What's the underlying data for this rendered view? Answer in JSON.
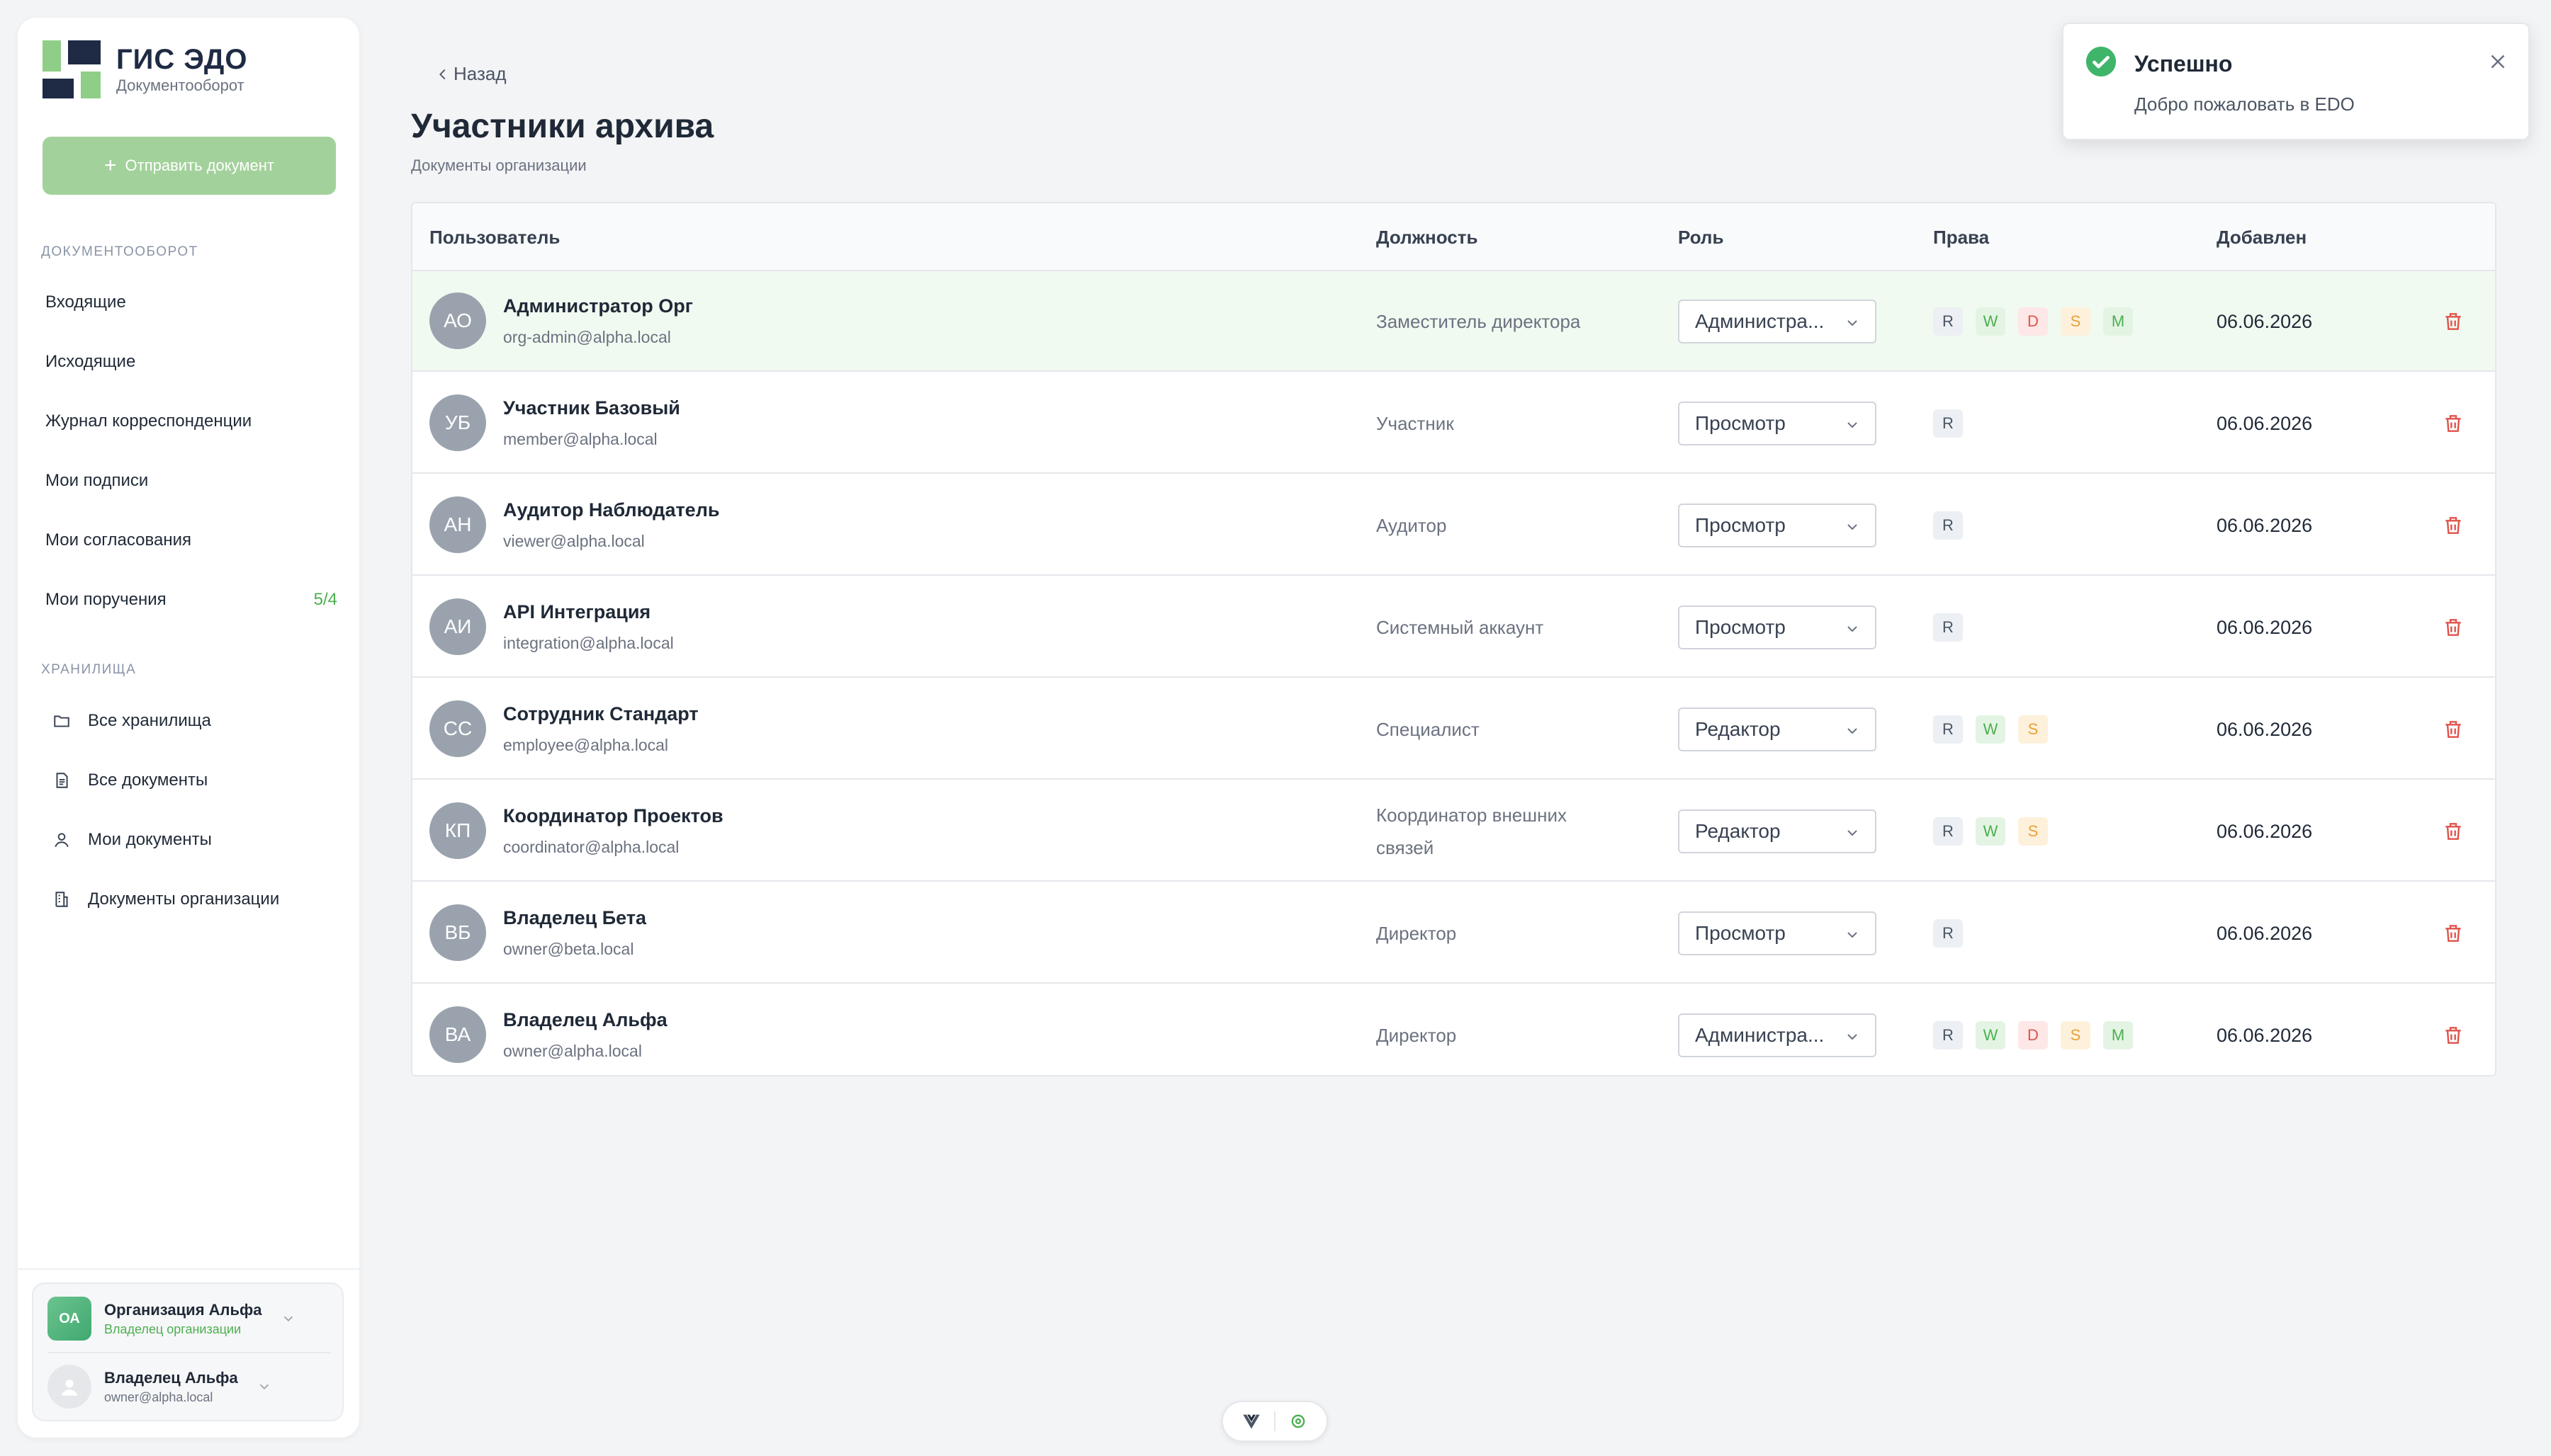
{
  "brand": {
    "title": "ГИС ЭДО",
    "subtitle": "Документооборот",
    "colors": {
      "green": "#8fce86",
      "navy": "#1f2a44"
    }
  },
  "sidebar": {
    "send_button": "Отправить документ",
    "section_docs": "ДОКУМЕНТООБОРОТ",
    "docs_items": [
      {
        "label": "Входящие"
      },
      {
        "label": "Исходящие"
      },
      {
        "label": "Журнал корреспонденции"
      },
      {
        "label": "Мои подписи"
      },
      {
        "label": "Мои согласования"
      },
      {
        "label": "Мои поручения",
        "count": "5/4"
      }
    ],
    "section_storage": "ХРАНИЛИЩА",
    "storage_items": [
      {
        "label": "Все хранилища",
        "icon": "folder-icon"
      },
      {
        "label": "Все документы",
        "icon": "document-icon"
      },
      {
        "label": "Мои документы",
        "icon": "user-icon"
      },
      {
        "label": "Документы организации",
        "icon": "building-icon"
      }
    ],
    "org": {
      "initials": "ОА",
      "name": "Организация Альфа",
      "role": "Владелец организации"
    },
    "user": {
      "name": "Владелец Альфа",
      "email": "owner@alpha.local"
    }
  },
  "header": {
    "back": "Назад",
    "title": "Участники архива",
    "subtitle": "Документы организации"
  },
  "table": {
    "columns": {
      "user": "Пользователь",
      "position": "Должность",
      "role": "Роль",
      "rights": "Права",
      "added": "Добавлен"
    },
    "rows": [
      {
        "initials": "АО",
        "name": "Администратор Орг",
        "email": "org-admin@alpha.local",
        "position": "Заместитель директора",
        "role": "Администра...",
        "rights": [
          "R",
          "W",
          "D",
          "S",
          "M"
        ],
        "added": "06.06.2026",
        "highlight": true
      },
      {
        "initials": "УБ",
        "name": "Участник Базовый",
        "email": "member@alpha.local",
        "position": "Участник",
        "role": "Просмотр",
        "rights": [
          "R"
        ],
        "added": "06.06.2026"
      },
      {
        "initials": "АН",
        "name": "Аудитор Наблюдатель",
        "email": "viewer@alpha.local",
        "position": "Аудитор",
        "role": "Просмотр",
        "rights": [
          "R"
        ],
        "added": "06.06.2026"
      },
      {
        "initials": "АИ",
        "name": "API Интеграция",
        "email": "integration@alpha.local",
        "position": "Системный аккаунт",
        "role": "Просмотр",
        "rights": [
          "R"
        ],
        "added": "06.06.2026"
      },
      {
        "initials": "СС",
        "name": "Сотрудник Стандарт",
        "email": "employee@alpha.local",
        "position": "Специалист",
        "role": "Редактор",
        "rights": [
          "R",
          "W",
          "S"
        ],
        "added": "06.06.2026"
      },
      {
        "initials": "КП",
        "name": "Координатор Проектов",
        "email": "coordinator@alpha.local",
        "position": "Координатор внешних связей",
        "role": "Редактор",
        "rights": [
          "R",
          "W",
          "S"
        ],
        "added": "06.06.2026"
      },
      {
        "initials": "ВБ",
        "name": "Владелец Бета",
        "email": "owner@beta.local",
        "position": "Директор",
        "role": "Просмотр",
        "rights": [
          "R"
        ],
        "added": "06.06.2026"
      },
      {
        "initials": "ВА",
        "name": "Владелец Альфа",
        "email": "owner@alpha.local",
        "position": "Директор",
        "role": "Администра...",
        "rights": [
          "R",
          "W",
          "D",
          "S",
          "M"
        ],
        "added": "06.06.2026"
      }
    ]
  },
  "toast": {
    "title": "Успешно",
    "message": "Добро пожаловать в EDO",
    "icon": "check-circle-icon",
    "accent": "#3fb56a"
  },
  "colors": {
    "accent_green": "#a3d19b",
    "danger": "#e0534a",
    "highlight_row": "#f1faf1"
  }
}
